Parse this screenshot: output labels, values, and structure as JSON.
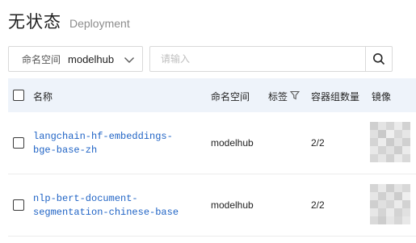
{
  "header": {
    "title": "无状态",
    "subtitle": "Deployment"
  },
  "filter": {
    "namespace_label": "命名空间",
    "namespace_value": "modelhub",
    "search_placeholder": "请输入"
  },
  "table": {
    "columns": [
      "名称",
      "命名空间",
      "标签",
      "容器组数量",
      "镜像"
    ],
    "rows": [
      {
        "name": "langchain-hf-embeddings-bge-base-zh",
        "namespace": "modelhub",
        "pods": "2/2"
      },
      {
        "name": "nlp-bert-document-segmentation-chinese-base",
        "namespace": "modelhub",
        "pods": "2/2"
      }
    ]
  },
  "colors": {
    "link": "#1f63c5",
    "header_bg": "#eef3fa",
    "border": "#d9d9d9"
  },
  "icons": [
    "chevron-down-icon",
    "search-icon",
    "filter-icon"
  ]
}
